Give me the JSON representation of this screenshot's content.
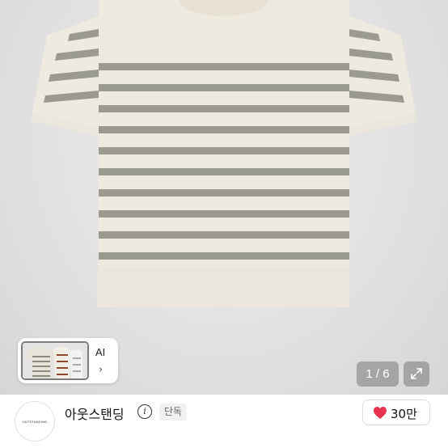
{
  "gallery": {
    "page_counter": "1 / 6",
    "expand_icon": "expand-icon",
    "thumbnail": {
      "ai_label": "AI",
      "chevron": "›"
    }
  },
  "seller": {
    "avatar_text": "OUTSTANDING",
    "name": "아웃스탠딩",
    "info_icon": "info-icon",
    "badge": "단독"
  },
  "like": {
    "count": "30만",
    "icon": "heart-icon",
    "color": "#e8344e"
  },
  "colors": {
    "sweater": "#efeae0",
    "stripe": "#9a9a8e",
    "background": "#dedede"
  }
}
